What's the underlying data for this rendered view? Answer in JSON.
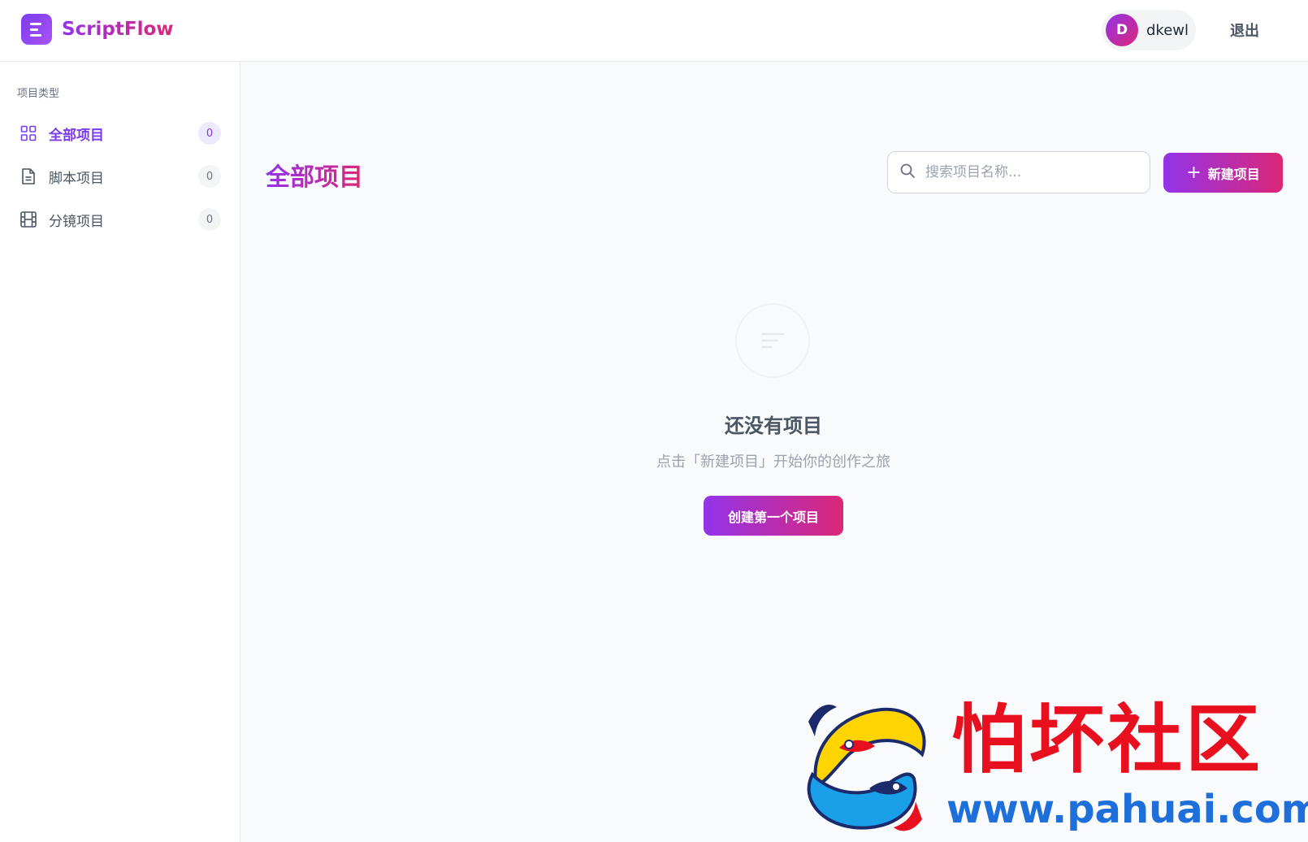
{
  "app": {
    "name": "ScriptFlow"
  },
  "user": {
    "avatar_initial": "D",
    "name": "dkewl",
    "logout_label": "退出"
  },
  "sidebar": {
    "heading": "项目类型",
    "items": [
      {
        "label": "全部项目",
        "count": "0",
        "icon": "grid-icon",
        "active": true
      },
      {
        "label": "脚本项目",
        "count": "0",
        "icon": "document-icon",
        "active": false
      },
      {
        "label": "分镜项目",
        "count": "0",
        "icon": "film-icon",
        "active": false
      }
    ]
  },
  "main": {
    "title": "全部项目",
    "search": {
      "placeholder": "搜索项目名称...",
      "value": ""
    },
    "new_button_label": "新建项目",
    "empty_state": {
      "icon": "list-icon",
      "title": "还没有项目",
      "subtitle": "点击「新建项目」开始你的创作之旅",
      "button_label": "创建第一个项目"
    }
  },
  "watermark": {
    "text": "怕坏社区",
    "url": "www.pahuai.com"
  },
  "colors": {
    "accent_start": "#9333ea",
    "accent_end": "#db2777",
    "active_nav": "#7c3aed",
    "watermark_red": "#e8101e",
    "watermark_blue": "#1e6fd9"
  }
}
